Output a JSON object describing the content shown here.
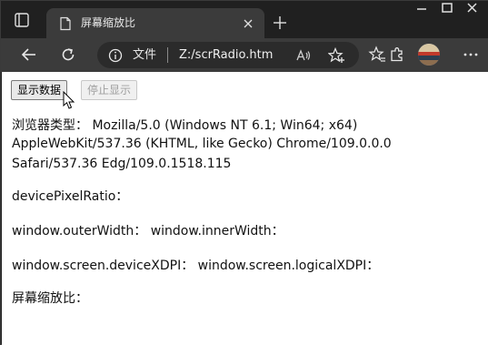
{
  "tab": {
    "title": "屏幕缩放比"
  },
  "omnibox": {
    "scheme_label": "文件",
    "url": "Z:/scrRadio.htm"
  },
  "buttons": {
    "show_label": "显示数据",
    "stop_label": "停止显示"
  },
  "content": {
    "ua_line1": "浏览器类型： Mozilla/5.0 (Windows NT 6.1; Win64; x64)",
    "ua_line2": "AppleWebKit/537.36 (KHTML, like Gecko) Chrome/109.0.0.0",
    "ua_line3": "Safari/537.36 Edg/109.0.1518.115",
    "dpr": "devicePixelRatio：",
    "outer_inner": "window.outerWidth：   window.innerWidth：",
    "dpi": "window.screen.deviceXDPI：   window.screen.logicalXDPI：",
    "ratio": "屏幕缩放比："
  },
  "colors": {
    "chrome_dark": "#202020",
    "toolbar": "#3b3b3b",
    "omnibox": "#2b2b2b",
    "page_bg": "#ffffff"
  },
  "icons": [
    "tab-actions-icon",
    "page-favicon-icon",
    "close-icon",
    "plus-icon",
    "minimize-icon",
    "maximize-icon",
    "window-close-icon",
    "back-arrow-icon",
    "refresh-icon",
    "info-icon",
    "read-aloud-icon",
    "favorite-add-icon",
    "favorites-icon",
    "extensions-icon",
    "profile-avatar",
    "more-icon",
    "mouse-pointer-icon"
  ]
}
